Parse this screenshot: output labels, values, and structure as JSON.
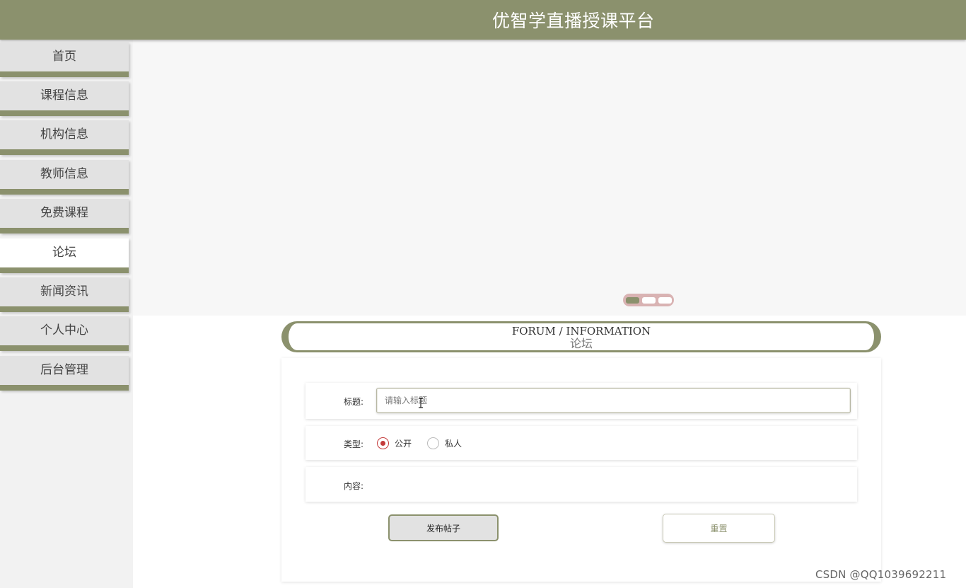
{
  "header": {
    "title": "优智学直播授课平台"
  },
  "sidebar": {
    "items": [
      {
        "label": "首页",
        "active": false
      },
      {
        "label": "课程信息",
        "active": false
      },
      {
        "label": "机构信息",
        "active": false
      },
      {
        "label": "教师信息",
        "active": false
      },
      {
        "label": "免费课程",
        "active": false
      },
      {
        "label": "论坛",
        "active": true
      },
      {
        "label": "新闻资讯",
        "active": false
      },
      {
        "label": "个人中心",
        "active": false
      },
      {
        "label": "后台管理",
        "active": false
      }
    ]
  },
  "banner": {
    "slide_count": 3,
    "active_slide": 1
  },
  "section": {
    "title_en": "FORUM / INFORMATION",
    "title_cn": "论坛"
  },
  "form": {
    "title_label": "标题:",
    "title_placeholder": "请输入标题",
    "title_value": "",
    "type_label": "类型:",
    "type_options": [
      {
        "label": "公开",
        "checked": true
      },
      {
        "label": "私人",
        "checked": false
      }
    ],
    "content_label": "内容:",
    "submit_label": "发布帖子",
    "reset_label": "重置"
  },
  "watermark": "CSDN @QQ1039692211",
  "colors": {
    "accent": "#8b916d",
    "radio_checked": "#c43a3a",
    "dots_bg": "#d9b3b3"
  },
  "icons": [
    "radio-checked-icon",
    "radio-unchecked-icon",
    "text-cursor-icon"
  ]
}
